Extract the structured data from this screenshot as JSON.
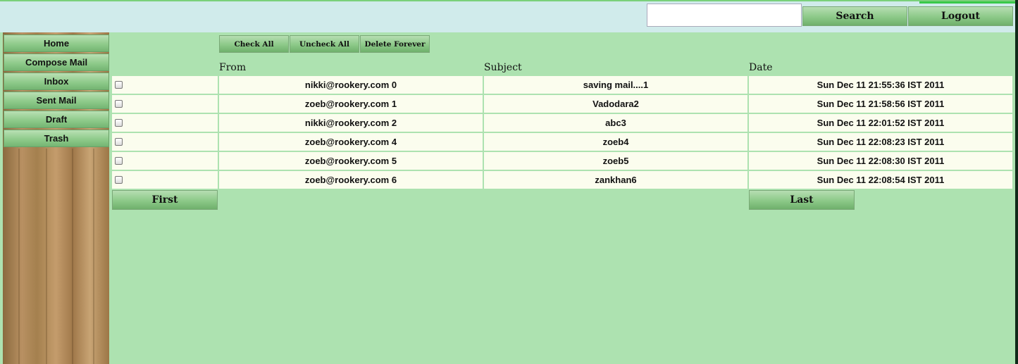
{
  "header": {
    "search_placeholder": "",
    "search_value": "",
    "search_label": "Search",
    "logout_label": "Logout"
  },
  "sidebar": {
    "items": [
      {
        "label": "Home"
      },
      {
        "label": "Compose Mail"
      },
      {
        "label": "Inbox"
      },
      {
        "label": "Sent Mail"
      },
      {
        "label": "Draft"
      },
      {
        "label": "Trash"
      }
    ]
  },
  "toolbar": {
    "check_all": "Check All",
    "uncheck_all": "Uncheck All",
    "delete_forever": "Delete Forever"
  },
  "table": {
    "headers": {
      "from": "From",
      "subject": "Subject",
      "date": "Date"
    },
    "rows": [
      {
        "from": "nikki@rookery.com 0",
        "subject": "saving mail....1",
        "date": "Sun Dec 11 21:55:36 IST 2011"
      },
      {
        "from": "zoeb@rookery.com 1",
        "subject": "Vadodara2",
        "date": "Sun Dec 11 21:58:56 IST 2011"
      },
      {
        "from": "nikki@rookery.com 2",
        "subject": "abc3",
        "date": "Sun Dec 11 22:01:52 IST 2011"
      },
      {
        "from": "zoeb@rookery.com 4",
        "subject": "zoeb4",
        "date": "Sun Dec 11 22:08:23 IST 2011"
      },
      {
        "from": "zoeb@rookery.com 5",
        "subject": "zoeb5",
        "date": "Sun Dec 11 22:08:30 IST 2011"
      },
      {
        "from": "zoeb@rookery.com 6",
        "subject": "zankhan6",
        "date": "Sun Dec 11 22:08:54 IST 2011"
      }
    ]
  },
  "pagination": {
    "first_label": "First",
    "last_label": "Last"
  },
  "colors": {
    "page_bg": "#ade2b0",
    "header_bg": "#d0ebeb",
    "row_bg": "#fbfdee",
    "button_green": "#8cc988"
  }
}
